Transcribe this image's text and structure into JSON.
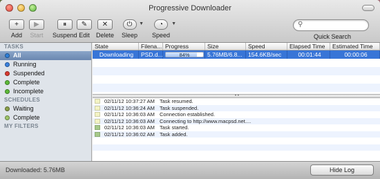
{
  "window": {
    "title": "Progressive Downloader"
  },
  "toolbar": {
    "buttons": [
      {
        "label": "Add",
        "glyph": "+"
      },
      {
        "label": "Start",
        "glyph": "▶"
      },
      {
        "label": "Suspend",
        "glyph": "⏸"
      },
      {
        "label": "Edit",
        "glyph": "✎"
      },
      {
        "label": "Delete",
        "glyph": "✕"
      },
      {
        "label": "Sleep",
        "glyph": "⏻"
      },
      {
        "label": "Speed",
        "glyph": "◔"
      }
    ],
    "search_label": "Quick Search",
    "search_placeholder": ""
  },
  "sidebar": {
    "tasks_header": "TASKS",
    "tasks": [
      {
        "label": "All",
        "color": "#2f7fd8"
      },
      {
        "label": "Running",
        "color": "#3b83e0"
      },
      {
        "label": "Suspended",
        "color": "#d93a32"
      },
      {
        "label": "Complete",
        "color": "#5dbb39"
      },
      {
        "label": "Incomplete",
        "color": "#5dbb39"
      }
    ],
    "schedules_header": "SCHEDULES",
    "schedules": [
      {
        "label": "Waiting",
        "color": "#8aa04a"
      },
      {
        "label": "Complete",
        "color": "#9fc66a"
      }
    ],
    "filters_header": "MY FILTERS"
  },
  "table": {
    "columns": [
      "State",
      "Filena...",
      "Progress",
      "Size",
      "Speed",
      "Elapsed Time",
      "Estimated Time"
    ],
    "rows": [
      {
        "state": "Downloading",
        "filename": "PSD.d...",
        "progress_text": "84%",
        "progress": 0.84,
        "size": "5.76MB/6.8...",
        "speed": "154.6KB/sec",
        "elapsed": "00:01:44",
        "estimated": "00:00:06"
      }
    ]
  },
  "log": {
    "entries": [
      {
        "time": "02/11/12 10:37:27 AM",
        "message": "Task resumed.",
        "color": "#f3f3c4"
      },
      {
        "time": "02/11/12 10:36:24 AM",
        "message": "Task suspended.",
        "color": "#f3f3c4"
      },
      {
        "time": "02/11/12 10:36:03 AM",
        "message": "Connection established.",
        "color": "#f3f3c4"
      },
      {
        "time": "02/11/12 10:36:03 AM",
        "message": "Connecting to http://www.macpsd.net....",
        "color": "#f3f3c4"
      },
      {
        "time": "02/11/12 10:36:03 AM",
        "message": "Task started.",
        "color": "#a6c98a"
      },
      {
        "time": "02/11/12 10:36:02 AM",
        "message": "Task added.",
        "color": "#a6c98a"
      }
    ]
  },
  "statusbar": {
    "text": "Downloaded: 5.76MB",
    "hide_log_label": "Hide Log"
  }
}
